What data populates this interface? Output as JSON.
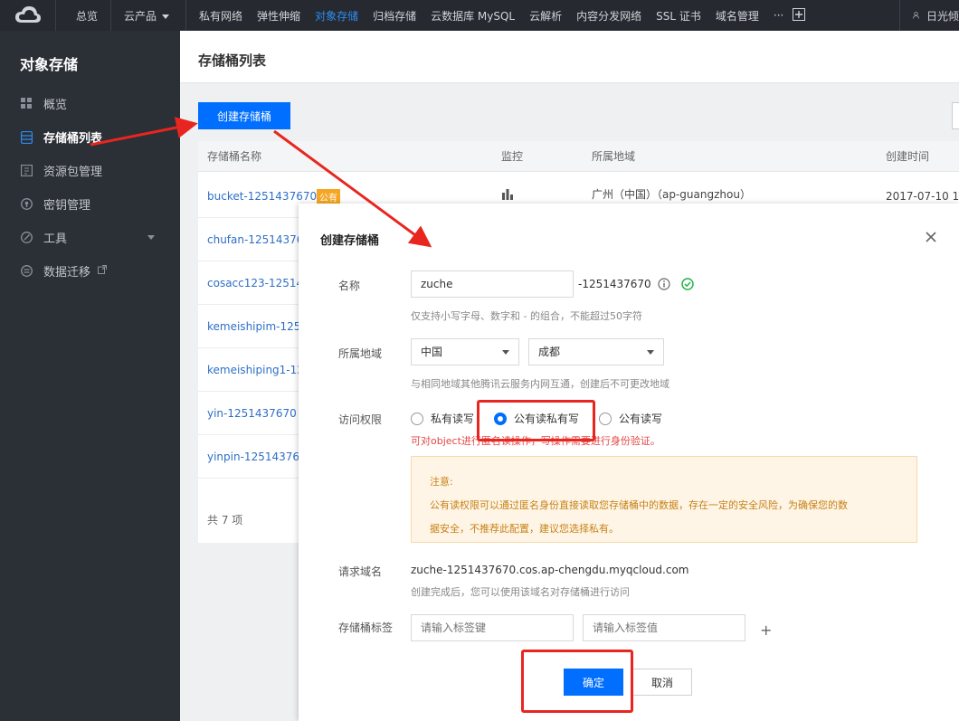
{
  "topnav": {
    "items": [
      "总览",
      "云产品",
      "私有网络",
      "弹性伸缩",
      "对象存储",
      "归档存储",
      "云数据库 MySQL",
      "云解析",
      "内容分发网络",
      "SSL 证书",
      "域名管理"
    ],
    "more": "···",
    "user": "日光倾"
  },
  "sidebar": {
    "title": "对象存储",
    "items": [
      {
        "label": "概览",
        "icon": "grid-icon"
      },
      {
        "label": "存储桶列表",
        "icon": "database-icon"
      },
      {
        "label": "资源包管理",
        "icon": "package-icon"
      },
      {
        "label": "密钥管理",
        "icon": "key-icon"
      },
      {
        "label": "工具",
        "icon": "tool-icon"
      },
      {
        "label": "数据迁移",
        "icon": "migrate-icon"
      }
    ]
  },
  "main": {
    "title": "存储桶列表",
    "create_label": "创建存储桶",
    "columns": [
      "存储桶名称",
      "监控",
      "所属地域",
      "创建时间"
    ],
    "rows": [
      {
        "name": "bucket-1251437670",
        "badge": "公有",
        "region": "广州（中国）（ap-guangzhou）",
        "time": "2017-07-10 11"
      },
      {
        "name": "chufan-125143767"
      },
      {
        "name": "cosacc123-12514"
      },
      {
        "name": "kemeishipim-125"
      },
      {
        "name": "kemeishiping1-12"
      },
      {
        "name": "yin-1251437670"
      },
      {
        "name": "yinpin-125143767"
      }
    ],
    "footer": "共 7 项"
  },
  "dialog": {
    "title": "创建存储桶",
    "name_label": "名称",
    "name_value": "zuche",
    "name_suffix": "-1251437670",
    "name_hint": "仅支持小写字母、数字和 - 的组合，不能超过50字符",
    "region_label": "所属地域",
    "region_country": "中国",
    "region_city": "成都",
    "region_hint": "与相同地域其他腾讯云服务内网互通，创建后不可更改地域",
    "access_label": "访问权限",
    "access_options": [
      "私有读写",
      "公有读私有写",
      "公有读写"
    ],
    "access_warning": "可对object进行匿名读操作，写操作需要进行身份验证。",
    "notice_title": "注意:",
    "notice_line1": "公有读权限可以通过匿名身份直接读取您存储桶中的数据，存在一定的安全风险，为确保您的数",
    "notice_line2": "据安全，不推荐此配置，建议您选择私有。",
    "domain_label": "请求域名",
    "domain_value": "zuche-1251437670.cos.ap-chengdu.myqcloud.com",
    "domain_hint": "创建完成后，您可以使用该域名对存储桶进行访问",
    "tag_label": "存储桶标签",
    "tag_key_placeholder": "请输入标签键",
    "tag_value_placeholder": "请输入标签值",
    "ok_label": "确定",
    "cancel_label": "取消"
  },
  "colors": {
    "accent": "#006eff",
    "annotation": "#e8261f",
    "warning": "#c68217"
  }
}
